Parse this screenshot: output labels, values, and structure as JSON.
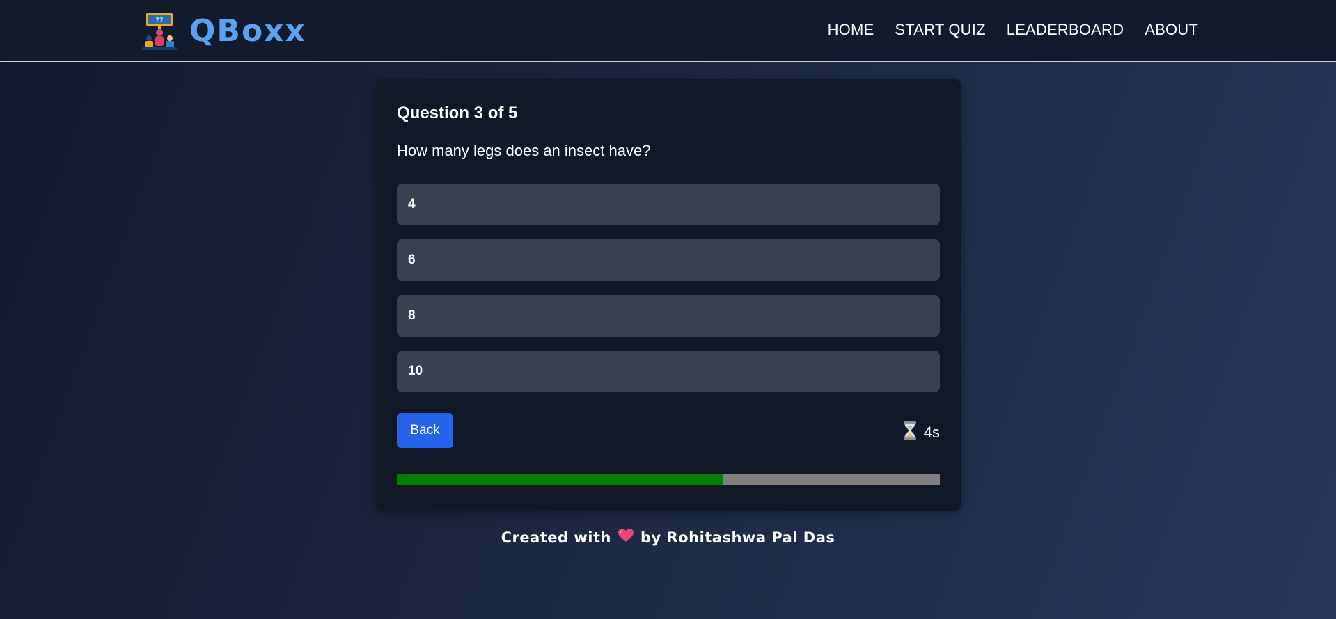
{
  "brand": {
    "name": "QBoxx",
    "logo_icon": "quiz-host-icon"
  },
  "nav": {
    "items": [
      {
        "label": "HOME"
      },
      {
        "label": "START QUIZ"
      },
      {
        "label": "LEADERBOARD"
      },
      {
        "label": "ABOUT"
      }
    ]
  },
  "quiz": {
    "heading": "Question 3 of 5",
    "question": "How many legs does an insect have?",
    "options": [
      {
        "label": "4"
      },
      {
        "label": "6"
      },
      {
        "label": "8"
      },
      {
        "label": "10"
      }
    ],
    "back_label": "Back",
    "timer_icon": "hourglass-icon",
    "timer_text": "4s",
    "progress_fraction": 0.6
  },
  "footer": {
    "prefix": "Created with",
    "heart_icon": "heart-icon",
    "suffix": "by Rohitashwa Pal Das"
  },
  "colors": {
    "brand_blue": "#5aa2f0",
    "card_bg": "#101828",
    "option_bg": "#374151",
    "button_blue": "#2563eb",
    "progress_fill": "#008000",
    "progress_track": "#808080",
    "heart": "#e8467a"
  }
}
